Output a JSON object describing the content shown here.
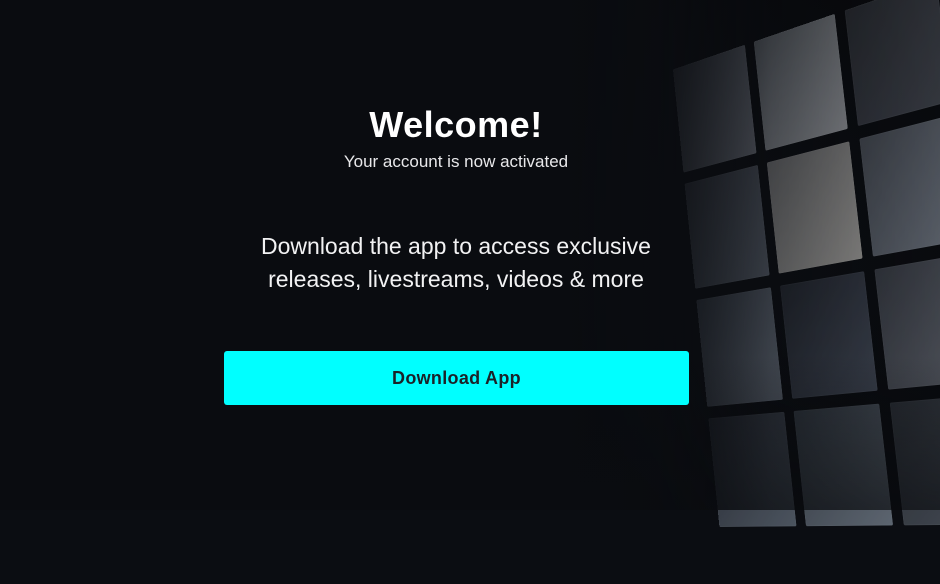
{
  "welcome": {
    "title": "Welcome!",
    "subtitle": "Your account is now activated"
  },
  "promo": {
    "line1": "Download the app to access exclusive",
    "line2": "releases, livestreams, videos & more"
  },
  "cta": {
    "label": "Download App",
    "color": "#00ffff"
  }
}
